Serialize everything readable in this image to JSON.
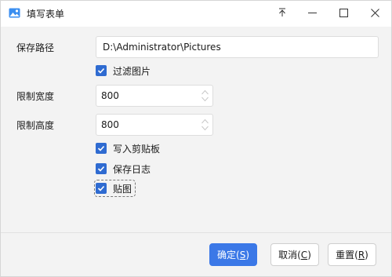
{
  "window": {
    "title": "填写表单",
    "icon": "image-icon"
  },
  "titlebar_buttons": [
    "pin-icon",
    "minimize-icon",
    "maximize-icon",
    "close-icon"
  ],
  "form": {
    "save_path": {
      "label": "保存路径",
      "value": "D:\\Administrator\\Pictures"
    },
    "filter_images": {
      "label": "过滤图片",
      "checked": true
    },
    "max_width": {
      "label": "限制宽度",
      "value": "800"
    },
    "max_height": {
      "label": "限制高度",
      "value": "800"
    },
    "write_clipboard": {
      "label": "写入剪贴板",
      "checked": true
    },
    "save_log": {
      "label": "保存日志",
      "checked": true
    },
    "paste_image": {
      "label": "贴图",
      "checked": true
    }
  },
  "buttons": {
    "ok": {
      "text": "确定(",
      "key": "S",
      "close": ")"
    },
    "cancel": {
      "text": "取消(",
      "key": "C",
      "close": ")"
    },
    "reset": {
      "text": "重置(",
      "key": "R",
      "close": ")"
    }
  },
  "colors": {
    "accent": "#3b78e7",
    "checkbox": "#2f6bd1",
    "background": "#f3f3f3"
  }
}
